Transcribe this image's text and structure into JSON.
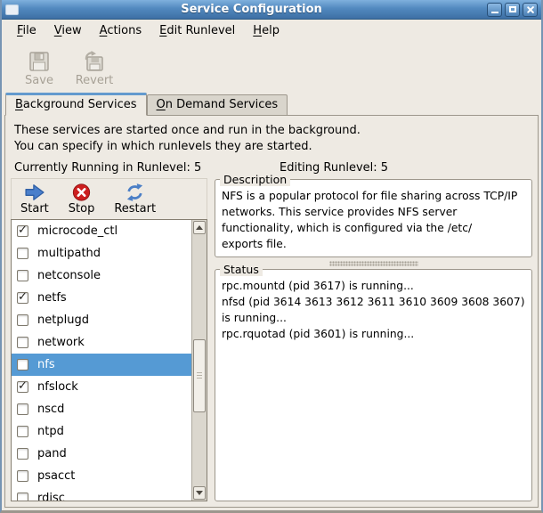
{
  "window": {
    "title": "Service Configuration"
  },
  "icons": {
    "app": "window-app-icon",
    "minimize": "minimize-icon",
    "maximize": "maximize-icon",
    "close": "close-icon",
    "save": "floppy-disk-icon",
    "revert": "floppy-revert-icon",
    "start": "blue-arrow-right-icon",
    "stop": "red-x-circle-icon",
    "restart": "blue-refresh-icon"
  },
  "menubar": {
    "items": [
      {
        "mn": "F",
        "rest": "ile"
      },
      {
        "mn": "V",
        "rest": "iew"
      },
      {
        "mn": "A",
        "rest": "ctions"
      },
      {
        "mn": "E",
        "rest": "dit Runlevel"
      },
      {
        "mn": "H",
        "rest": "elp"
      }
    ]
  },
  "toolbar": {
    "save_label": "Save",
    "revert_label": "Revert"
  },
  "tabs": {
    "background": {
      "mn": "B",
      "rest": "ackground Services"
    },
    "on_demand": {
      "mn": "O",
      "rest": "n Demand Services"
    }
  },
  "intro": {
    "line1": "These services are started once and run in the background.",
    "line2": "You can specify in which runlevels they are started."
  },
  "runlevels": {
    "current": "Currently Running in Runlevel: 5",
    "editing": "Editing Runlevel: 5"
  },
  "actions": {
    "start_label": "Start",
    "stop_label": "Stop",
    "restart_label": "Restart"
  },
  "services": [
    {
      "name": "microcode_ctl",
      "checked": true,
      "selected": false
    },
    {
      "name": "multipathd",
      "checked": false,
      "selected": false
    },
    {
      "name": "netconsole",
      "checked": false,
      "selected": false
    },
    {
      "name": "netfs",
      "checked": true,
      "selected": false
    },
    {
      "name": "netplugd",
      "checked": false,
      "selected": false
    },
    {
      "name": "network",
      "checked": false,
      "selected": false
    },
    {
      "name": "nfs",
      "checked": false,
      "selected": true
    },
    {
      "name": "nfslock",
      "checked": true,
      "selected": false
    },
    {
      "name": "nscd",
      "checked": false,
      "selected": false
    },
    {
      "name": "ntpd",
      "checked": false,
      "selected": false
    },
    {
      "name": "pand",
      "checked": false,
      "selected": false
    },
    {
      "name": "psacct",
      "checked": false,
      "selected": false
    },
    {
      "name": "rdisc",
      "checked": false,
      "selected": false
    }
  ],
  "description_panel": {
    "title": "Description",
    "lines": [
      "NFS is a popular protocol for file sharing across TCP/IP",
      "networks. This service provides NFS server",
      "functionality, which is configured via the /etc/",
      "exports file."
    ]
  },
  "status_panel": {
    "title": "Status",
    "lines": [
      "rpc.mountd (pid 3617) is running...",
      "nfsd (pid 3614 3613 3612 3611 3610 3609 3608 3607)",
      "is running...",
      "rpc.rquotad (pid 3601) is running..."
    ]
  },
  "colors": {
    "selection": "#559ad4",
    "titlebar": "#4a80b6",
    "stop_red": "#cc1f1f",
    "action_blue": "#4b7fc6",
    "window_bg": "#eeeae3"
  }
}
